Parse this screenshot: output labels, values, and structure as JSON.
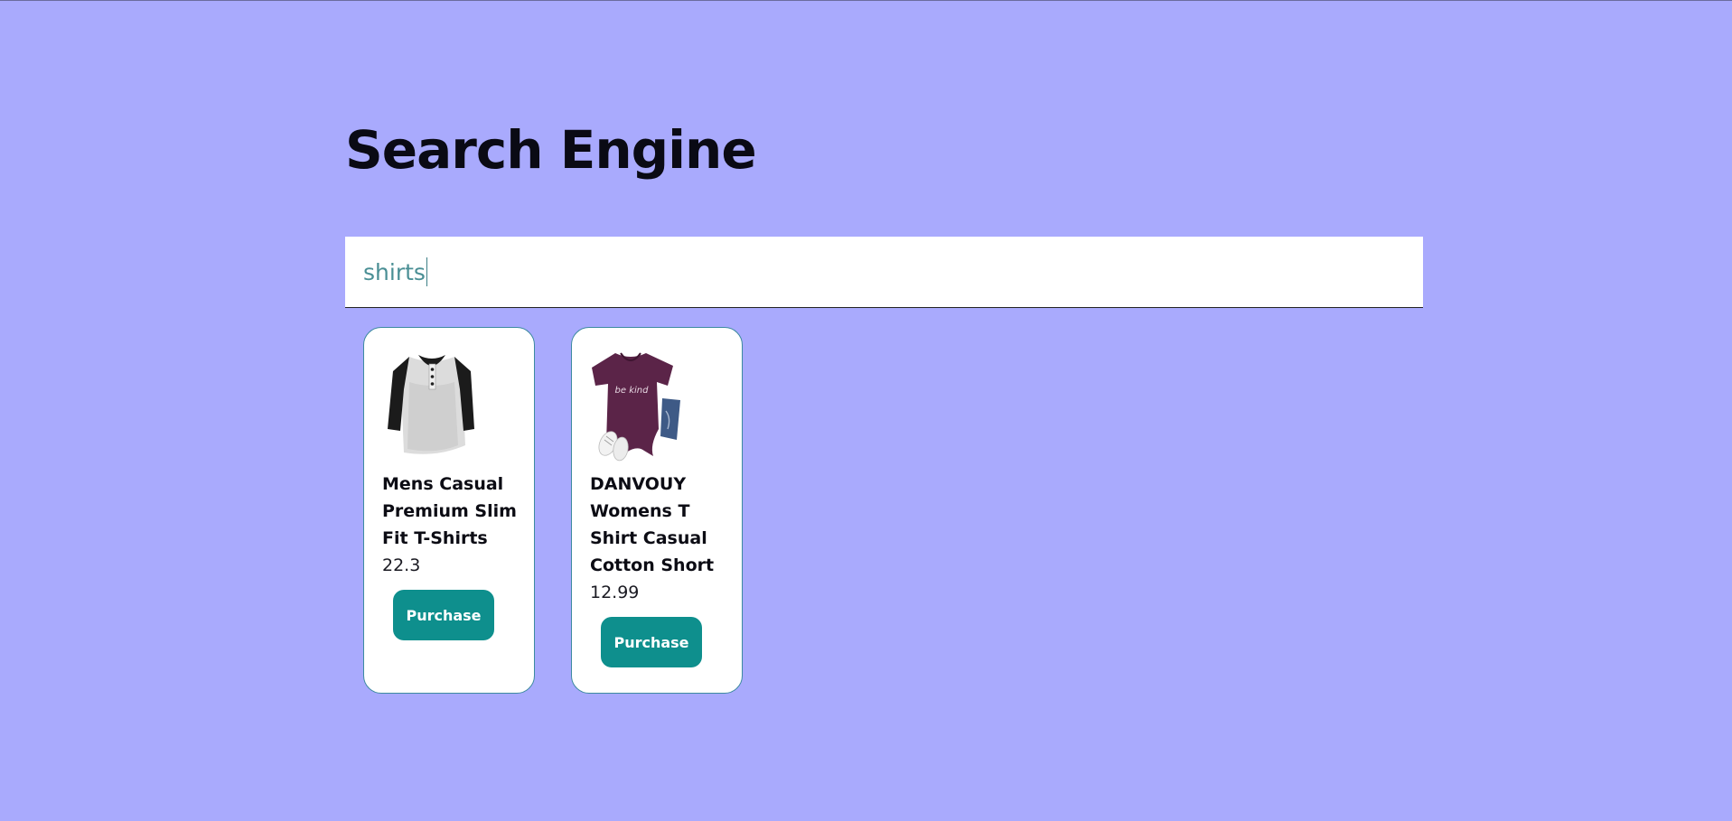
{
  "header": {
    "title": "Search Engine"
  },
  "search": {
    "value": "shirts"
  },
  "results": [
    {
      "name": "Mens Casual Premium Slim Fit T-Shirts",
      "price": "22.3",
      "button_label": "Purchase",
      "image_icon": "raglan-henley-shirt-image"
    },
    {
      "name": "DANVOUY Womens T Shirt Casual Cotton Short",
      "price": "12.99",
      "button_label": "Purchase",
      "image_icon": "purple-be-kind-tshirt-image",
      "image_text": "be kind"
    }
  ],
  "colors": {
    "background": "#a9aafd",
    "button": "#0e8f8d",
    "card_border": "#3c8aa0",
    "search_text": "#4a8f95"
  }
}
